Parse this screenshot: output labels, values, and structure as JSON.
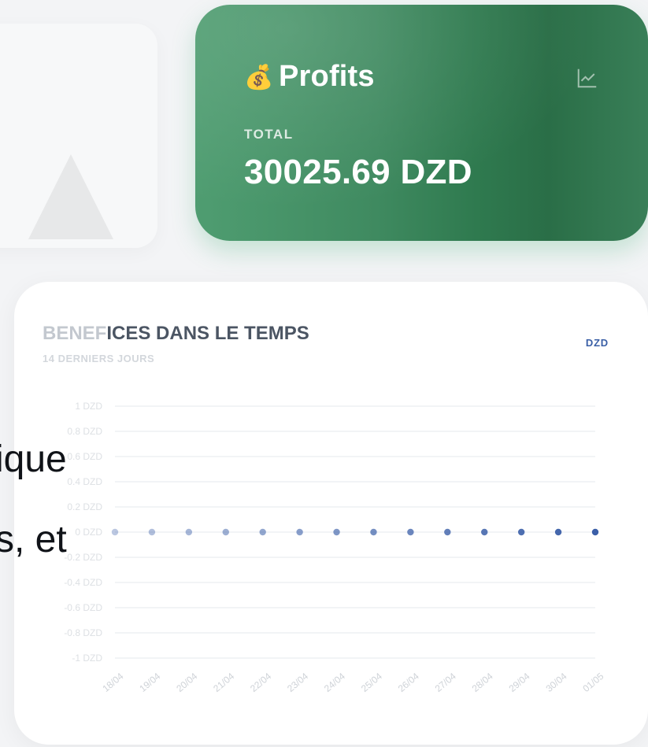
{
  "profits_card": {
    "icon": "moneybag-icon",
    "title": "Profits",
    "total_label": "TOTAL",
    "total_value": "30025.69 DZD",
    "action_icon": "line-chart-icon",
    "colors": {
      "start": "#4f9d71",
      "end": "#2a6e47",
      "text": "#ffffff"
    }
  },
  "chart_card": {
    "title_fade": "BENEF",
    "title_main": "ICES DANS LE TEMPS",
    "subtitle": "14 DERNIERS JOURS",
    "currency": "DZD"
  },
  "overlay": {
    "line1": "ique",
    "line2": "s, et"
  },
  "chart_data": {
    "type": "line",
    "title": "BENEFICES DANS LE TEMPS",
    "subtitle": "14 DERNIERS JOURS",
    "ylabel": "",
    "xlabel": "",
    "y_ticks": [
      "1 DZD",
      "0.8 DZD",
      "0.6 DZD",
      "0.4 DZD",
      "0.2 DZD",
      "0 DZD",
      "-0.2 DZD",
      "-0.4 DZD",
      "-0.6 DZD",
      "-0.8 DZD",
      "-1 DZD"
    ],
    "ylim": [
      -1,
      1
    ],
    "categories": [
      "18/04",
      "19/04",
      "20/04",
      "21/04",
      "22/04",
      "23/04",
      "24/04",
      "25/04",
      "26/04",
      "27/04",
      "28/04",
      "29/04",
      "30/04",
      "01/05"
    ],
    "series": [
      {
        "values": [
          0,
          0,
          0,
          0,
          0,
          0,
          0,
          0,
          0,
          0,
          0,
          0,
          0,
          0
        ],
        "color": "#3b5fa8"
      }
    ],
    "grid": true,
    "legend": "none"
  }
}
